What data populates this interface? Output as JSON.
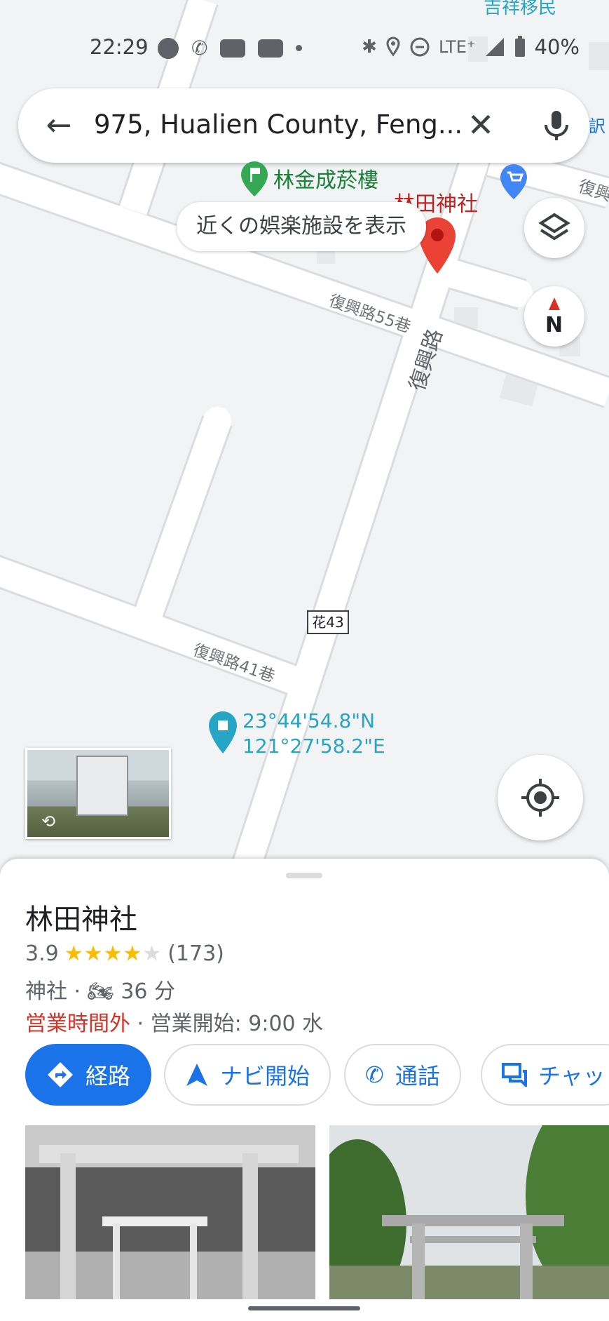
{
  "status_bar": {
    "time": "22:29",
    "network": "LTE⁺",
    "battery": "40%",
    "icons": [
      "line-icon",
      "wifi-call-icon",
      "youtube-icon",
      "youtube-icon",
      "dot-icon",
      "bluetooth-icon",
      "location-icon",
      "dnd-icon",
      "signal-icon",
      "battery-icon"
    ]
  },
  "search": {
    "query": "975, Hualien County, Feng..."
  },
  "map": {
    "chip": "近くの娯楽施設を表示",
    "poi_store": "林金成菸樓",
    "poi_shrine": "林田神社",
    "road_main": "復興路",
    "road_lane55": "復興路55巷",
    "road_lane41": "復興路41巷",
    "road_route": "花43",
    "road_top_right": "復興",
    "coord_lat": "23°44'54.8\"N",
    "coord_lng": "121°27'58.2\"E",
    "top_partial_label": "吉祥移民",
    "compass_letter": "N",
    "colors": {
      "pin_red": "#ea4335",
      "poi_green": "#34a853",
      "marker_teal": "#26a5c4",
      "shop_blue": "#4285f4"
    }
  },
  "place": {
    "name": "林田神社",
    "rating": "3.9",
    "stars": 3.9,
    "reviews": "(173)",
    "category": "神社",
    "travel_time": "36 分",
    "status_closed": "営業時間外",
    "opening": "· 営業開始: 9:00 水",
    "separator": "·"
  },
  "actions": {
    "directions": "経路",
    "start": "ナビ開始",
    "call": "通話",
    "chat": "チャッ"
  },
  "accent_color": "#1a73e8"
}
